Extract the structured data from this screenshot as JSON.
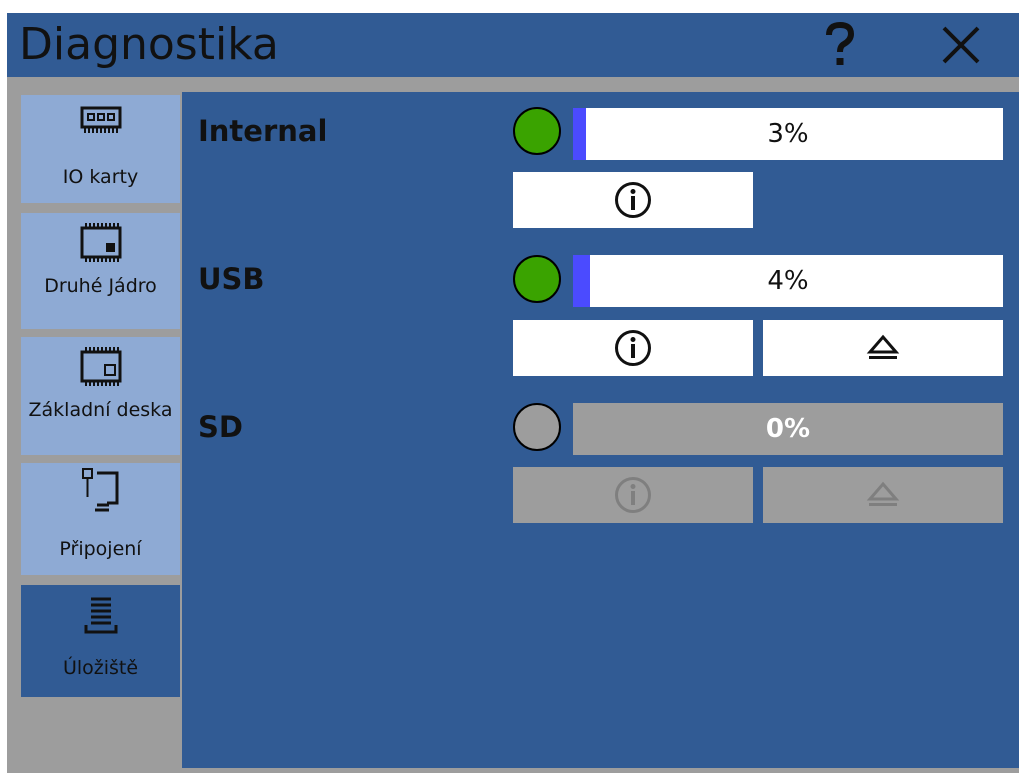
{
  "window": {
    "title": "Diagnostika"
  },
  "sidebar": {
    "items": [
      {
        "label": "IO karty",
        "icon": "io-card-icon",
        "active": false
      },
      {
        "label": "Druhé Jádro",
        "icon": "chip-icon",
        "active": false
      },
      {
        "label": "Základní deska",
        "icon": "motherboard-icon",
        "active": false
      },
      {
        "label": "Připojení",
        "icon": "connection-icon",
        "active": false
      },
      {
        "label": "Úložiště",
        "icon": "storage-icon",
        "active": true
      }
    ]
  },
  "drives": [
    {
      "name": "Internal",
      "status_color": "#3aa300",
      "usage_percent": 3,
      "usage_text": "3%",
      "enabled": true,
      "has_eject": false
    },
    {
      "name": "USB",
      "status_color": "#3aa300",
      "usage_percent": 4,
      "usage_text": "4%",
      "enabled": true,
      "has_eject": true
    },
    {
      "name": "SD",
      "status_color": "#9d9d9d",
      "usage_percent": 0,
      "usage_text": "0%",
      "enabled": false,
      "has_eject": true
    }
  ],
  "colors": {
    "titlebar": "#315b94",
    "content_bg": "#315b94",
    "sidebar_item": "#8eaad4",
    "frame": "#9d9d9d",
    "progress_fill": "#4b4bff",
    "ok_led": "#3aa300"
  }
}
